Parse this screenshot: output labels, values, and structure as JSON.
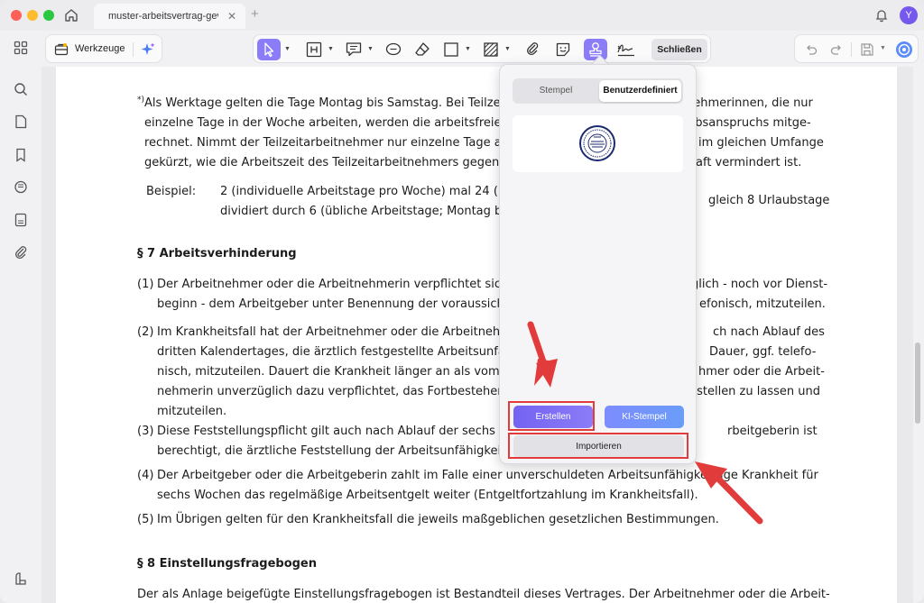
{
  "window": {
    "tab_title": "muster-arbeitsvertrag-gev",
    "avatar_letter": "Y"
  },
  "toolbar": {
    "werkzeuge_label": "Werkzeuge",
    "close_label": "Schließen"
  },
  "document": {
    "footnote_mark": "*)",
    "p1_l1": "Als Werktage gelten die Tage Montag bis Samstag. Bei Teilzeit",
    "p1_l1b": "nehmerinnen, die nur",
    "p1_l2": "einzelne Tage in der Woche arbeiten, werden die arbeitsfreien",
    "p1_l2b": "ubsanspruchs mitge-",
    "p1_l3": "rechnet. Nimmt der Teilzeitarbeitnehmer nur einzelne Tage als",
    "p1_l3b": "im gleichen Umfange",
    "p1_l4": "gekürzt, wie die Arbeitszeit des Teilzeitarbeitnehmers gegenüb",
    "p1_l4b": "aft vermindert ist.",
    "beispiel_label": "Beispiel:",
    "beispiel_l1": "2 (individuelle Arbeitstage pro Woche) mal 24 (U",
    "beispiel_l1b": "gleich 8 Urlaubstage",
    "beispiel_l2": "dividiert durch 6 (übliche Arbeitstage; Montag bis",
    "s7_heading": "§ 7 Arbeitsverhinderung",
    "s7_1_num": "(1)",
    "s7_1_l1": "Der Arbeitnehmer oder die Arbeitnehmerin verpflichtet sich,",
    "s7_1_l1b": "glich - noch vor Dienst-",
    "s7_1_l2": "beginn - dem Arbeitgeber unter Benennung der voraussichtl",
    "s7_1_l2b": "efonisch, mitzuteilen.",
    "s7_2_num": "(2)",
    "s7_2_l1": "Im Krankheitsfall hat der Arbeitnehmer oder die Arbeitnehm",
    "s7_2_l1b": "ch nach Ablauf des",
    "s7_2_l2": "dritten Kalendertages, die ärztlich festgestellte Arbeitsunfä",
    "s7_2_l2b": "Dauer, ggf. telefo-",
    "s7_2_l3": "nisch, mitzuteilen. Dauert die Krankheit länger an als vom A",
    "s7_2_l3b": "hmer oder die Arbeit-",
    "s7_2_l4": "nehmerin unverzüglich dazu verpflichtet, das Fortbestehen d",
    "s7_2_l4b": "tstellen zu lassen und",
    "s7_2_l5": "mitzuteilen.",
    "s7_3_num": "(3)",
    "s7_3_l1": "Diese Feststellungspflicht gilt auch nach Ablauf der sechs W",
    "s7_3_l1b": "rbeitgeberin ist",
    "s7_3_l2": "berechtigt, die ärztliche Feststellung der Arbeitsunfähigkeit",
    "s7_4_num": "(4)",
    "s7_4_l1": "Der Arbeitgeber oder die Arbeitgeberin zahlt im Falle einer unverschuldeten Arbeitsunfähigkeit",
    "s7_4_l1b": "olge Krankheit für",
    "s7_4_l2": "sechs Wochen das regelmäßige Arbeitsentgelt weiter (Entgeltfortzahlung im Krankheitsfall).",
    "s7_5_num": "(5)",
    "s7_5_l1": "Im Übrigen gelten für den Krankheitsfall die jeweils maßgeblichen gesetzlichen Bestimmungen.",
    "s8_heading": "§ 8 Einstellungsfragebogen",
    "s8_l1": "Der als Anlage beigefügte Einstellungsfragebogen ist Bestandteil dieses Vertrages. Der Arbeitnehmer oder die Arbeit-"
  },
  "stamp_popup": {
    "tab_stempel": "Stempel",
    "tab_benutzerdefiniert": "Benutzerdefiniert",
    "btn_erstellen": "Erstellen",
    "btn_ki_stempel": "KI-Stempel",
    "btn_importieren": "Importieren"
  },
  "colors": {
    "accent": "#8b7cf8",
    "annotation_red": "#e23b3b",
    "ki_button": "#6a9cf8"
  }
}
